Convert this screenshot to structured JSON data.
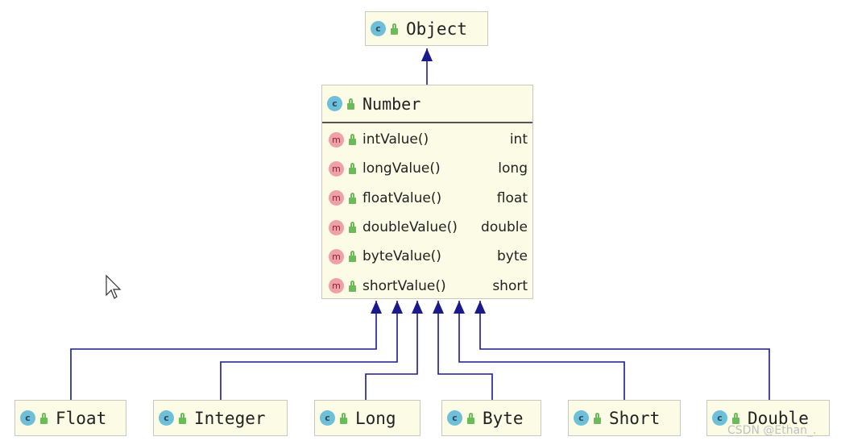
{
  "diagram": {
    "root": {
      "name": "Object",
      "icon": "class-icon"
    },
    "number": {
      "name": "Number",
      "icon": "abstract-class-icon",
      "methods": [
        {
          "name": "intValue()",
          "returns": "int"
        },
        {
          "name": "longValue()",
          "returns": "long"
        },
        {
          "name": "floatValue()",
          "returns": "float"
        },
        {
          "name": "doubleValue()",
          "returns": "double"
        },
        {
          "name": "byteValue()",
          "returns": "byte"
        },
        {
          "name": "shortValue()",
          "returns": "short"
        }
      ]
    },
    "subclasses": [
      {
        "name": "Float"
      },
      {
        "name": "Integer"
      },
      {
        "name": "Long"
      },
      {
        "name": "Byte"
      },
      {
        "name": "Short"
      },
      {
        "name": "Double"
      }
    ],
    "icon_letters": {
      "class": "c",
      "method": "m"
    },
    "edge_color": "#1a1a8c"
  },
  "watermark": "CSDN @Ethan_."
}
